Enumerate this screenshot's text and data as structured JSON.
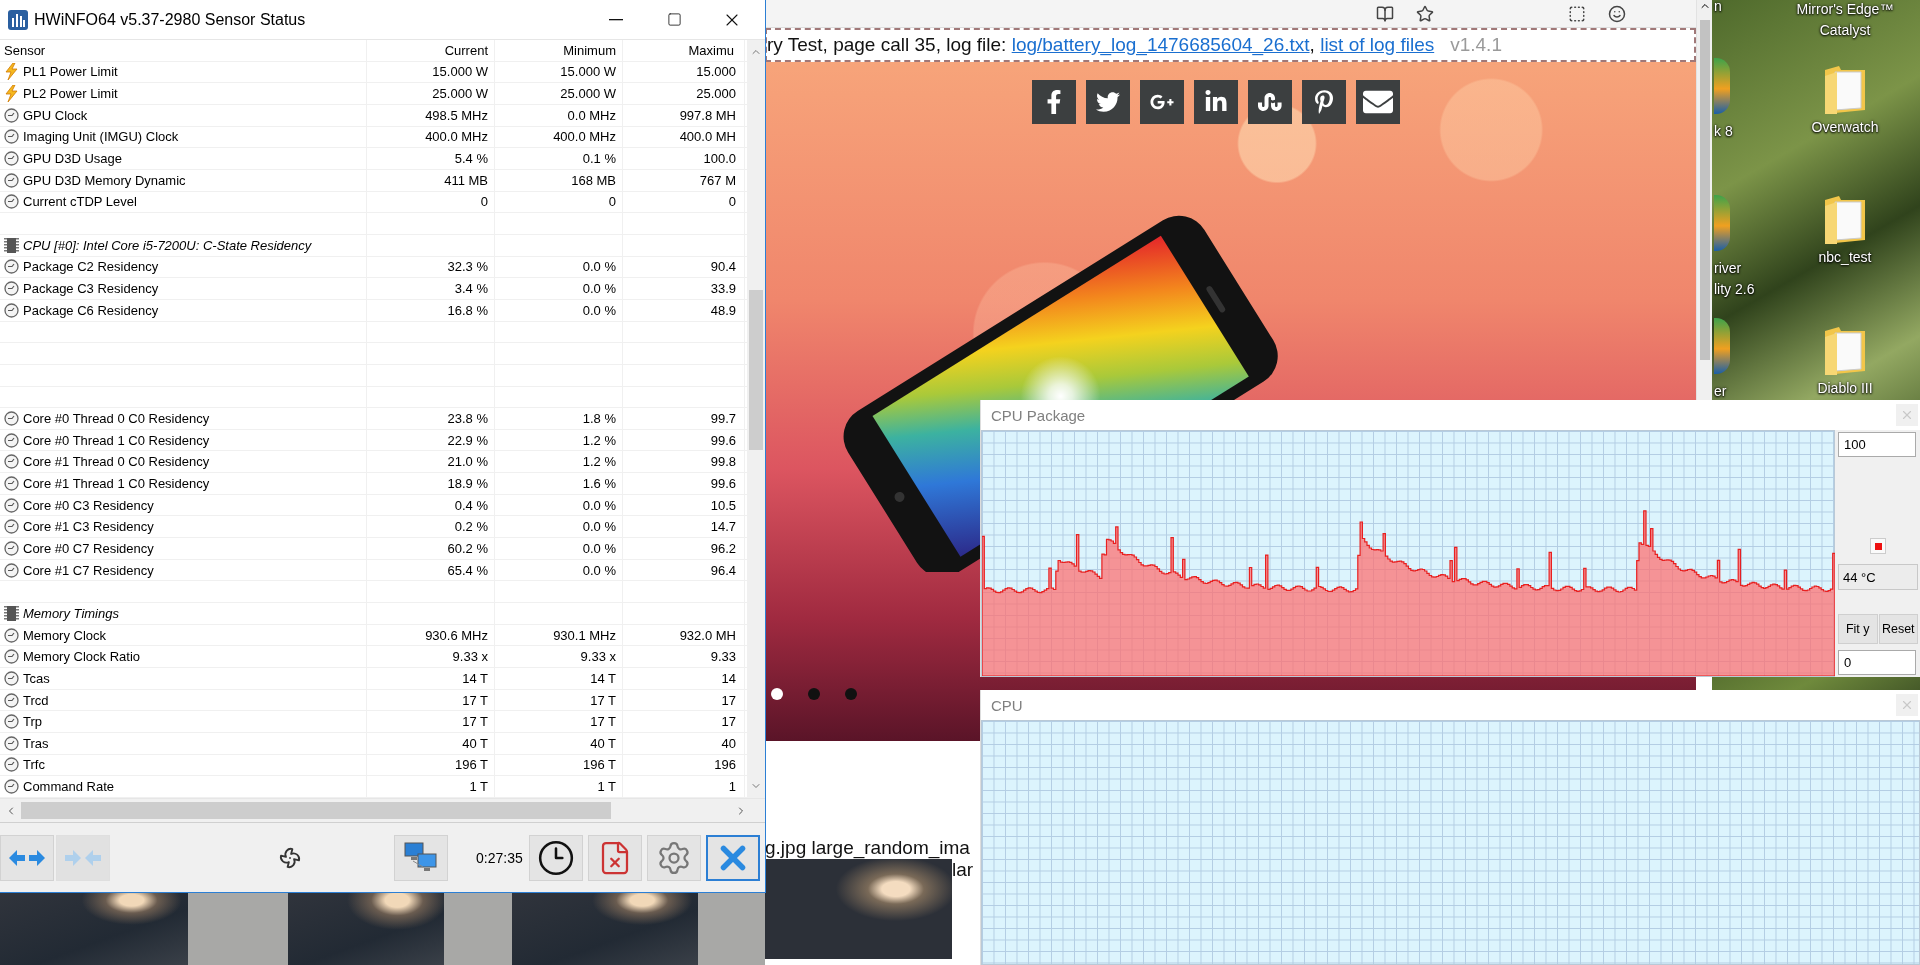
{
  "hwinfo": {
    "title": "HWiNFO64 v5.37-2980 Sensor Status",
    "columns": [
      "Sensor",
      "Current",
      "Minimum",
      "Maximu"
    ],
    "rows": [
      {
        "kind": "power",
        "name": "PL1 Power Limit",
        "current": "15.000 W",
        "minimum": "15.000 W",
        "maximum": "15.000"
      },
      {
        "kind": "power",
        "name": "PL2 Power Limit",
        "current": "25.000 W",
        "minimum": "25.000 W",
        "maximum": "25.000"
      },
      {
        "kind": "sensor",
        "name": "GPU Clock",
        "current": "498.5 MHz",
        "minimum": "0.0 MHz",
        "maximum": "997.8 MH"
      },
      {
        "kind": "sensor",
        "name": "Imaging Unit (IMGU) Clock",
        "current": "400.0 MHz",
        "minimum": "400.0 MHz",
        "maximum": "400.0 MH"
      },
      {
        "kind": "sensor",
        "name": "GPU D3D Usage",
        "current": "5.4 %",
        "minimum": "0.1 %",
        "maximum": "100.0"
      },
      {
        "kind": "sensor",
        "name": "GPU D3D Memory Dynamic",
        "current": "411 MB",
        "minimum": "168 MB",
        "maximum": "767 M"
      },
      {
        "kind": "sensor",
        "name": "Current cTDP Level",
        "current": "0",
        "minimum": "0",
        "maximum": "0"
      },
      {
        "kind": "blank"
      },
      {
        "kind": "section",
        "name": "CPU [#0]: Intel Core i5-7200U: C-State Residency"
      },
      {
        "kind": "sensor",
        "name": "Package C2 Residency",
        "current": "32.3 %",
        "minimum": "0.0 %",
        "maximum": "90.4"
      },
      {
        "kind": "sensor",
        "name": "Package C3 Residency",
        "current": "3.4 %",
        "minimum": "0.0 %",
        "maximum": "33.9"
      },
      {
        "kind": "sensor",
        "name": "Package C6 Residency",
        "current": "16.8 %",
        "minimum": "0.0 %",
        "maximum": "48.9"
      },
      {
        "kind": "blank"
      },
      {
        "kind": "blank"
      },
      {
        "kind": "blank"
      },
      {
        "kind": "blank"
      },
      {
        "kind": "sensor",
        "name": "Core #0 Thread 0 C0 Residency",
        "current": "23.8 %",
        "minimum": "1.8 %",
        "maximum": "99.7"
      },
      {
        "kind": "sensor",
        "name": "Core #0 Thread 1 C0 Residency",
        "current": "22.9 %",
        "minimum": "1.2 %",
        "maximum": "99.6"
      },
      {
        "kind": "sensor",
        "name": "Core #1 Thread 0 C0 Residency",
        "current": "21.0 %",
        "minimum": "1.2 %",
        "maximum": "99.8"
      },
      {
        "kind": "sensor",
        "name": "Core #1 Thread 1 C0 Residency",
        "current": "18.9 %",
        "minimum": "1.6 %",
        "maximum": "99.6"
      },
      {
        "kind": "sensor",
        "name": "Core #0 C3 Residency",
        "current": "0.4 %",
        "minimum": "0.0 %",
        "maximum": "10.5"
      },
      {
        "kind": "sensor",
        "name": "Core #1 C3 Residency",
        "current": "0.2 %",
        "minimum": "0.0 %",
        "maximum": "14.7"
      },
      {
        "kind": "sensor",
        "name": "Core #0 C7 Residency",
        "current": "60.2 %",
        "minimum": "0.0 %",
        "maximum": "96.2"
      },
      {
        "kind": "sensor",
        "name": "Core #1 C7 Residency",
        "current": "65.4 %",
        "minimum": "0.0 %",
        "maximum": "96.4"
      },
      {
        "kind": "blank"
      },
      {
        "kind": "section",
        "name": "Memory Timings"
      },
      {
        "kind": "sensor",
        "name": "Memory Clock",
        "current": "930.6 MHz",
        "minimum": "930.1 MHz",
        "maximum": "932.0 MH"
      },
      {
        "kind": "sensor",
        "name": "Memory Clock Ratio",
        "current": "9.33 x",
        "minimum": "9.33 x",
        "maximum": "9.33"
      },
      {
        "kind": "sensor",
        "name": "Tcas",
        "current": "14 T",
        "minimum": "14 T",
        "maximum": "14"
      },
      {
        "kind": "sensor",
        "name": "Trcd",
        "current": "17 T",
        "minimum": "17 T",
        "maximum": "17"
      },
      {
        "kind": "sensor",
        "name": "Trp",
        "current": "17 T",
        "minimum": "17 T",
        "maximum": "17"
      },
      {
        "kind": "sensor",
        "name": "Tras",
        "current": "40 T",
        "minimum": "40 T",
        "maximum": "40"
      },
      {
        "kind": "sensor",
        "name": "Trfc",
        "current": "196 T",
        "minimum": "196 T",
        "maximum": "196"
      },
      {
        "kind": "sensor",
        "name": "Command Rate",
        "current": "1 T",
        "minimum": "1 T",
        "maximum": "1"
      }
    ],
    "toolbar": {
      "left_buttons": [
        {
          "kind": "expand",
          "disabled": false,
          "focused": false
        },
        {
          "kind": "collapse",
          "disabled": true,
          "focused": false
        }
      ],
      "middle_buttons": [
        {
          "kind": "fan",
          "disabled": false,
          "focused": false
        },
        {
          "kind": "network",
          "disabled": false,
          "focused": false
        }
      ],
      "timer": "0:27:35",
      "right_buttons": [
        {
          "kind": "clock",
          "disabled": false,
          "focused": false
        },
        {
          "kind": "report",
          "disabled": false,
          "focused": false
        },
        {
          "kind": "settings",
          "disabled": false,
          "focused": false
        },
        {
          "kind": "close",
          "disabled": false,
          "focused": true
        }
      ]
    }
  },
  "browser": {
    "header": {
      "text": "ry Test, page call 35, log file: ",
      "links": [
        "log/battery_log_1476685604_26.txt",
        "list of log files"
      ],
      "separator": ", ",
      "version": "v1.4.1"
    },
    "share_icons": [
      {
        "kind": "facebook"
      },
      {
        "kind": "twitter"
      },
      {
        "kind": "googleplus"
      },
      {
        "kind": "linkedin"
      },
      {
        "kind": "stumbleupon"
      },
      {
        "kind": "pinterest"
      },
      {
        "kind": "mail"
      }
    ],
    "slider_dots": [
      {
        "selected": true
      },
      {
        "selected": false
      },
      {
        "selected": false
      }
    ],
    "caption_lines": [
      "g.jpg large_random_ima",
      "lar"
    ]
  },
  "graphs": [
    {
      "kind": "line",
      "title": "CPU Package",
      "max": "100",
      "min": "0",
      "reading": "44 °C",
      "buttons": [
        "Fit y",
        "Reset"
      ]
    },
    {
      "kind": "empty",
      "title": "CPU"
    }
  ],
  "desktop": {
    "left_column": [
      {
        "kind": "label_only",
        "label_lines": [
          "n"
        ]
      },
      {
        "kind": "app",
        "label_lines": [
          "k 8"
        ]
      },
      {
        "kind": "app",
        "label_lines": [
          "river",
          "lity 2.6"
        ]
      },
      {
        "kind": "app",
        "label_lines": [
          "er"
        ]
      }
    ],
    "right_column": [
      {
        "kind": "label_only",
        "label_lines": [
          "Mirror's Edge™",
          "Catalyst"
        ]
      },
      {
        "kind": "folder",
        "label_lines": [
          "Overwatch"
        ]
      },
      {
        "kind": "folder",
        "label_lines": [
          "nbc_test"
        ]
      },
      {
        "kind": "folder",
        "label_lines": [
          "Diablo III"
        ]
      }
    ]
  }
}
